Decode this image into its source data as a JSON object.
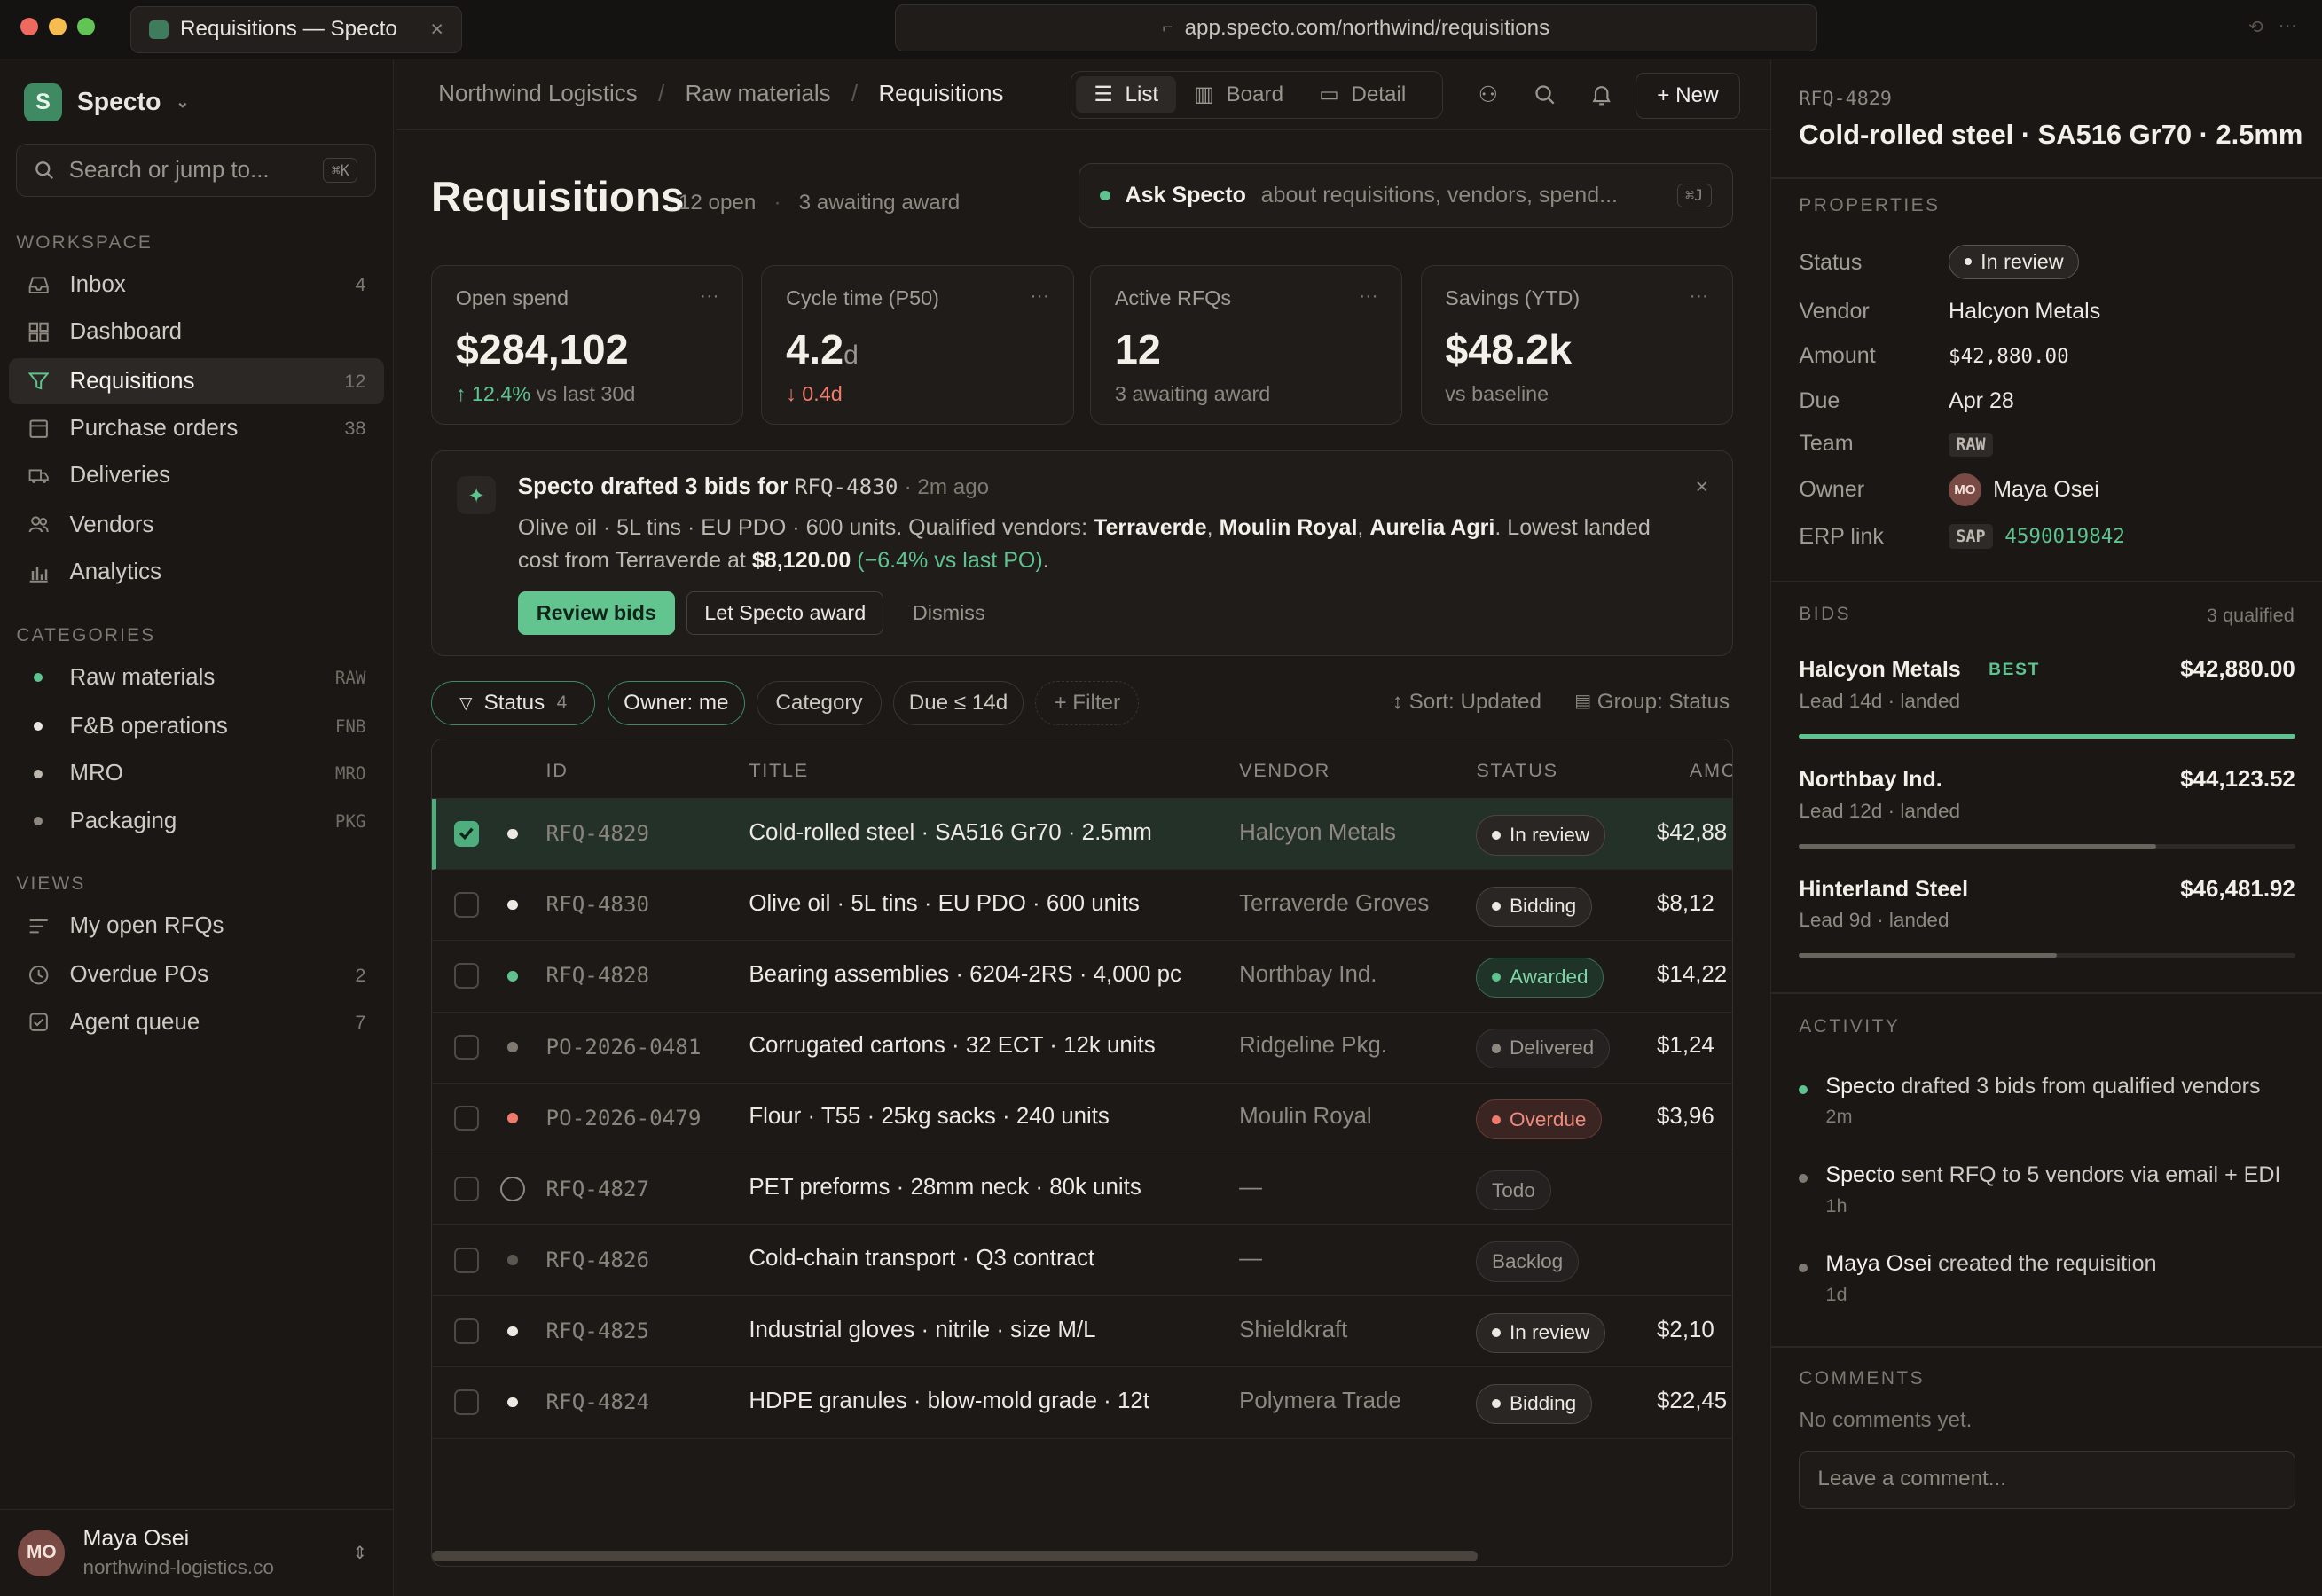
{
  "browser": {
    "tab_title": "Requisitions — Specto",
    "url": "app.specto.com/northwind/requisitions"
  },
  "sidebar": {
    "workspace": "Specto",
    "logo_letter": "S",
    "search_placeholder": "Search or jump to...",
    "search_shortcut": "⌘K",
    "sections": {
      "workspace": "WORKSPACE",
      "categories": "CATEGORIES",
      "views": "VIEWS"
    },
    "nav": [
      {
        "label": "Inbox",
        "count": "4",
        "icon": "inbox-icon"
      },
      {
        "label": "Dashboard",
        "count": "",
        "icon": "grid-icon"
      },
      {
        "label": "Requisitions",
        "count": "12",
        "icon": "filter-icon"
      },
      {
        "label": "Purchase orders",
        "count": "38",
        "icon": "document-icon"
      },
      {
        "label": "Deliveries",
        "count": "",
        "icon": "truck-icon"
      },
      {
        "label": "Vendors",
        "count": "",
        "icon": "users-icon"
      },
      {
        "label": "Analytics",
        "count": "",
        "icon": "bar-chart-icon"
      }
    ],
    "categories": [
      {
        "label": "Raw materials",
        "code": "RAW",
        "color": "#5ec38f"
      },
      {
        "label": "F&B operations",
        "code": "FNB",
        "color": "#e9e6e1"
      },
      {
        "label": "MRO",
        "code": "MRO",
        "color": "#bdb7b0"
      },
      {
        "label": "Packaging",
        "code": "PKG",
        "color": "#8e8881"
      }
    ],
    "views": [
      {
        "label": "My open RFQs",
        "count": ""
      },
      {
        "label": "Overdue POs",
        "count": "2"
      },
      {
        "label": "Agent queue",
        "count": "7"
      }
    ],
    "user": {
      "name": "Maya Osei",
      "email": "northwind-logistics.co",
      "initials": "MO"
    }
  },
  "topbar": {
    "breadcrumbs": [
      "Northwind Logistics",
      "Raw materials",
      "Requisitions"
    ],
    "views": [
      "List",
      "Board",
      "Detail"
    ],
    "new_label": "+ New"
  },
  "header": {
    "title": "Requisitions",
    "open_count": "12 open",
    "awaiting": "3 awaiting award",
    "ask_label": "Ask Specto",
    "ask_placeholder": "about requisitions, vendors, spend...",
    "ask_shortcut": "⌘J"
  },
  "metrics": [
    {
      "label": "Open spend",
      "value": "$284,102",
      "unit": "",
      "delta": "↑ 12.4%",
      "delta_note": " vs last 30d",
      "trend": "up"
    },
    {
      "label": "Cycle time (P50)",
      "value": "4.2",
      "unit": "d",
      "delta": "↓ 0.4d",
      "delta_note": "",
      "trend": "down"
    },
    {
      "label": "Active RFQs",
      "value": "12",
      "unit": "",
      "delta": "",
      "delta_note": "3 awaiting award",
      "trend": ""
    },
    {
      "label": "Savings (YTD)",
      "value": "$48.2k",
      "unit": "",
      "delta": "",
      "delta_note": "vs baseline",
      "trend": ""
    }
  ],
  "banner": {
    "title": "Specto drafted 3 bids for",
    "rfq": "RFQ-4830",
    "time": "· 2m ago",
    "line1_pre": "Olive oil · 5L tins · EU PDO · 600 units. Qualified vendors: ",
    "vendors": [
      "Terraverde",
      "Moulin Royal",
      "Aurelia Agri"
    ],
    "line1_post": ". Lowest landed",
    "line2_pre": "cost from Terraverde at ",
    "line2_amount": "$8,120.00",
    "line2_delta": "(−6.4% vs last PO)",
    "line2_end": ".",
    "review": "Review bids",
    "award": "Let Specto award",
    "dismiss": "Dismiss"
  },
  "filters": {
    "status": "Status",
    "status_count": "4",
    "owner": "Owner: me",
    "category": "Category",
    "due": "Due ≤ 14d",
    "add": "+ Filter",
    "sort": "↕ Sort: Updated",
    "group": "Group: Status"
  },
  "table": {
    "columns": [
      "ID",
      "TITLE",
      "VENDOR",
      "STATUS",
      "AMO"
    ],
    "rows": [
      {
        "id": "RFQ-4829",
        "title": "Cold-rolled steel · SA516 Gr70 · 2.5mm",
        "vendor": "Halcyon Metals",
        "status": "In review",
        "amount": "$42,88",
        "selected": true,
        "dot": "#ece8e2",
        "status_dot": "#ece8e2"
      },
      {
        "id": "RFQ-4830",
        "title": "Olive oil · 5L tins · EU PDO · 600 units",
        "vendor": "Terraverde Groves",
        "status": "Bidding",
        "amount": "$8,12",
        "selected": false,
        "dot": "#ece8e2",
        "status_dot": "#ece8e2"
      },
      {
        "id": "RFQ-4828",
        "title": "Bearing assemblies · 6204-2RS · 4,000 pc",
        "vendor": "Northbay Ind.",
        "status": "Awarded",
        "amount": "$14,22",
        "selected": false,
        "dot": "#5ec38f",
        "status_dot": "#5ec38f"
      },
      {
        "id": "PO-2026-0481",
        "title": "Corrugated cartons · 32 ECT · 12k units",
        "vendor": "Ridgeline Pkg.",
        "status": "Delivered",
        "amount": "$1,24",
        "selected": false,
        "dot": "#7f7972",
        "status_dot": "#8e8881"
      },
      {
        "id": "PO-2026-0479",
        "title": "Flour · T55 · 25kg sacks · 240 units",
        "vendor": "Moulin Royal",
        "status": "Overdue",
        "amount": "$3,96",
        "selected": false,
        "dot": "#ef7b6c",
        "status_dot": "#ef7b6c"
      },
      {
        "id": "RFQ-4827",
        "title": "PET preforms · 28mm neck · 80k units",
        "vendor": "—",
        "status": "Todo",
        "amount": "",
        "selected": false,
        "dot": "ring",
        "status_dot": ""
      },
      {
        "id": "RFQ-4826",
        "title": "Cold-chain transport · Q3 contract",
        "vendor": "—",
        "status": "Backlog",
        "amount": "",
        "selected": false,
        "dot": "#5c5650",
        "status_dot": ""
      },
      {
        "id": "RFQ-4825",
        "title": "Industrial gloves · nitrile · size M/L",
        "vendor": "Shieldkraft",
        "status": "In review",
        "amount": "$2,10",
        "selected": false,
        "dot": "#ece8e2",
        "status_dot": "#ece8e2"
      },
      {
        "id": "RFQ-4824",
        "title": "HDPE granules · blow-mold grade · 12t",
        "vendor": "Polymera Trade",
        "status": "Bidding",
        "amount": "$22,45",
        "selected": false,
        "dot": "#ece8e2",
        "status_dot": "#ece8e2"
      }
    ]
  },
  "detail": {
    "id": "RFQ-4829",
    "title": "Cold-rolled steel · SA516 Gr70 · 2.5mm",
    "properties_header": "PROPERTIES",
    "props": {
      "status_label": "Status",
      "status": "In review",
      "vendor_label": "Vendor",
      "vendor": "Halcyon Metals",
      "amount_label": "Amount",
      "amount": "$42,880.00",
      "due_label": "Due",
      "due": "Apr 28",
      "team_label": "Team",
      "team": "RAW",
      "owner_label": "Owner",
      "owner": "Maya Osei",
      "owner_initials": "MO",
      "erp_label": "ERP link",
      "erp_system": "SAP",
      "erp_id": "4590019842"
    },
    "bids_header": "BIDS",
    "bids_count": "3 qualified",
    "bids": [
      {
        "vendor": "Halcyon Metals",
        "badge": "BEST",
        "amount": "$42,880.00",
        "lead": "Lead 14d · landed",
        "score": 1.0
      },
      {
        "vendor": "Northbay Ind.",
        "badge": "",
        "amount": "$44,123.52",
        "lead": "Lead 12d · landed",
        "score": 0.72
      },
      {
        "vendor": "Hinterland Steel",
        "badge": "",
        "amount": "$46,481.92",
        "lead": "Lead 9d · landed",
        "score": 0.52
      }
    ],
    "activity_header": "ACTIVITY",
    "activity": [
      {
        "actor": "Specto",
        "text": " drafted 3 bids from qualified vendors",
        "time": "2m"
      },
      {
        "actor": "Specto",
        "text": " sent RFQ to 5 vendors via email + EDI",
        "time": "1h"
      },
      {
        "actor": "Maya Osei",
        "text": " created the requisition",
        "time": "1d"
      }
    ],
    "comments_header": "COMMENTS",
    "no_comments": "No comments yet.",
    "comment_placeholder": "Leave a comment..."
  }
}
